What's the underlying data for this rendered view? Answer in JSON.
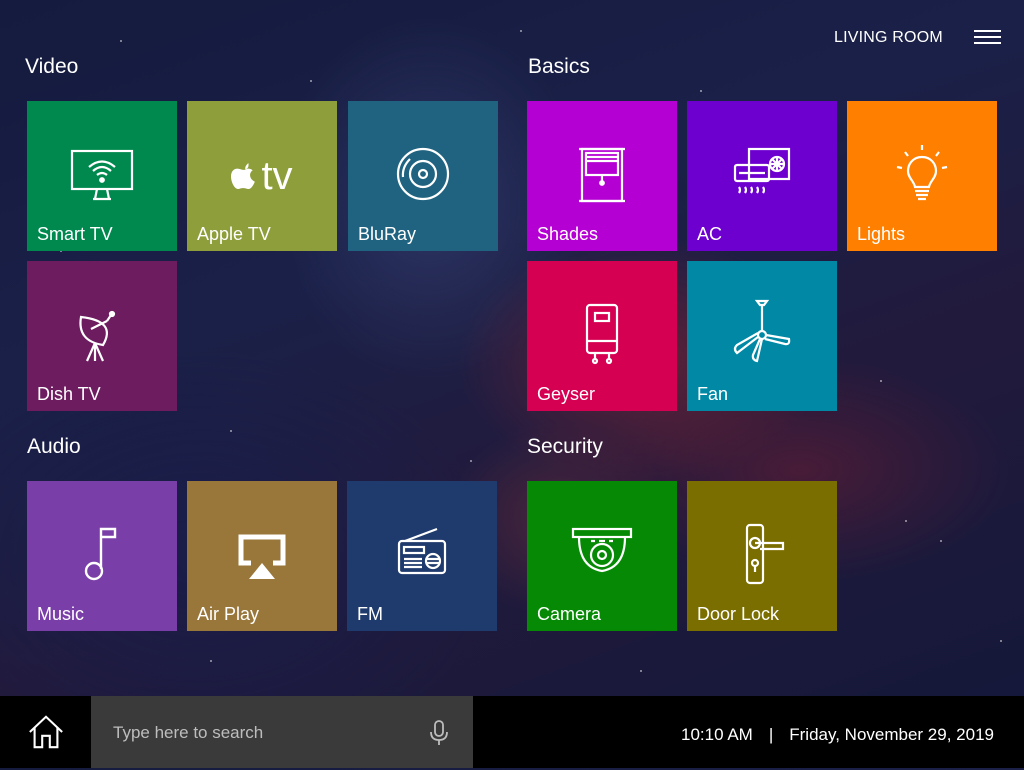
{
  "header": {
    "room": "LIVING ROOM",
    "menu_icon": "hamburger-menu-icon"
  },
  "sections": {
    "video": {
      "title": "Video"
    },
    "basics": {
      "title": "Basics"
    },
    "audio": {
      "title": "Audio"
    },
    "security": {
      "title": "Security"
    }
  },
  "tiles": {
    "smart_tv": {
      "label": "Smart TV",
      "icon": "tv-wifi-icon",
      "color": "#00894f"
    },
    "apple_tv": {
      "label": "Apple TV",
      "logo_text": "tv",
      "icon": "apple-tv-logo-icon",
      "color": "#8d9e3b"
    },
    "bluray": {
      "label": "BluRay",
      "icon": "disc-icon",
      "color": "#1f6380"
    },
    "dish_tv": {
      "label": "Dish TV",
      "icon": "satellite-dish-icon",
      "color": "#6d1c60"
    },
    "shades": {
      "label": "Shades",
      "icon": "window-shade-icon",
      "color": "#b400d3"
    },
    "ac": {
      "label": "AC",
      "icon": "air-conditioner-icon",
      "color": "#6e00cf"
    },
    "lights": {
      "label": "Lights",
      "icon": "light-bulb-icon",
      "color": "#ff7f00"
    },
    "geyser": {
      "label": "Geyser",
      "icon": "water-heater-icon",
      "color": "#d60052"
    },
    "fan": {
      "label": "Fan",
      "icon": "ceiling-fan-icon",
      "color": "#0088a5"
    },
    "music": {
      "label": "Music",
      "icon": "music-note-icon",
      "color": "#7a3ea8"
    },
    "air_play": {
      "label": "Air Play",
      "icon": "airplay-icon",
      "color": "#99763a"
    },
    "fm": {
      "label": "FM",
      "icon": "radio-icon",
      "color": "#1f3a6c"
    },
    "camera": {
      "label": "Camera",
      "icon": "security-camera-icon",
      "color": "#068a05"
    },
    "door_lock": {
      "label": "Door Lock",
      "icon": "door-lock-icon",
      "color": "#7b6e00"
    }
  },
  "bottombar": {
    "home_icon": "home-icon",
    "search_placeholder": "Type here to search",
    "mic_icon": "microphone-icon",
    "time": "10:10 AM",
    "separator": "|",
    "date": "Friday, November 29, 2019"
  }
}
